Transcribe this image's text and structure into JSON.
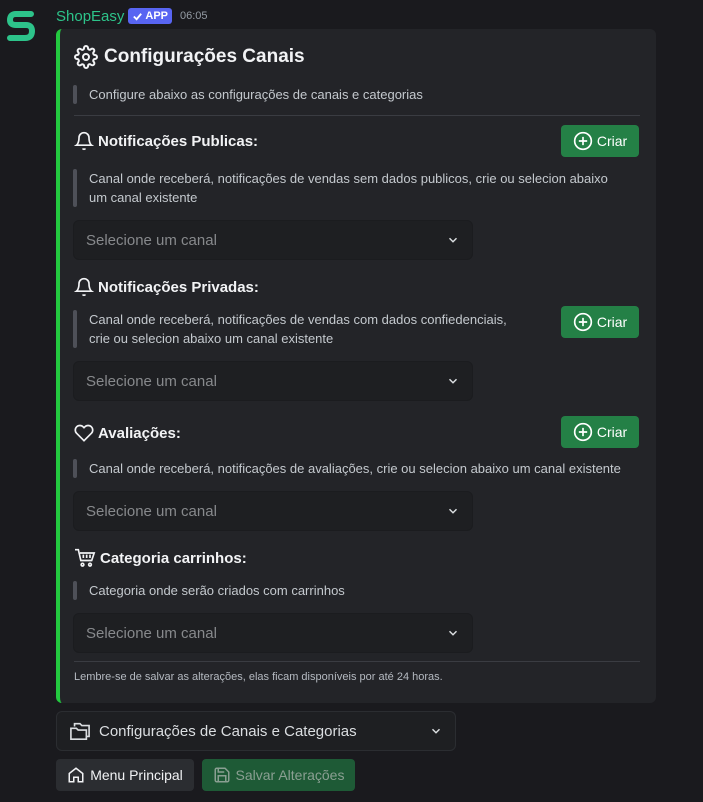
{
  "message": {
    "bot_name": "ShopEasy",
    "app_badge": "APP",
    "timestamp": "06:05"
  },
  "embed": {
    "accent_color": "#23c93f",
    "title": "Configurações Canais",
    "description": "Configure abaixo as configurações de canais e categorias",
    "sections": [
      {
        "icon": "bell-icon",
        "title": "Notificações Publicas:",
        "description_lines": [
          "Canal onde receberá, notificações de vendas sem dados publicos, crie ou selecion abaixo",
          "um canal existente"
        ],
        "create_label": "Criar",
        "select_placeholder": "Selecione um canal"
      },
      {
        "icon": "bell-icon",
        "title": "Notificações Privadas:",
        "description_lines": [
          "Canal onde receberá, notificações de vendas com dados confiedenciais,",
          "crie ou selecion abaixo um canal existente"
        ],
        "create_label": "Criar",
        "select_placeholder": "Selecione um canal"
      },
      {
        "icon": "heart-icon",
        "title": "Avaliações:",
        "description_lines": [
          "Canal onde receberá, notificações de avaliações, crie ou selecion abaixo um canal existente"
        ],
        "create_label": "Criar",
        "select_placeholder": "Selecione um canal"
      },
      {
        "icon": "cart-icon",
        "title": "Categoria carrinhos:",
        "description_lines": [
          "Categoria onde serão criados com carrinhos"
        ],
        "select_placeholder": "Selecione um canal"
      }
    ],
    "footer": "Lembre-se de salvar as alterações, elas ficam disponíveis por até 24 horas."
  },
  "components": {
    "config_select": "Configurações de Canais e Categorias",
    "menu_button": "Menu Principal",
    "save_button": "Salvar Alterações"
  }
}
